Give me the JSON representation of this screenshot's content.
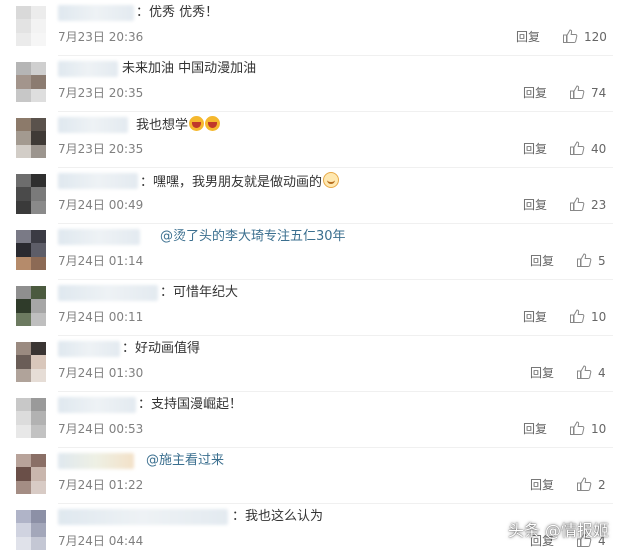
{
  "comments": [
    {
      "text_plain": "：优秀 优秀！",
      "mention": "",
      "emojis": [],
      "time": "7月23日 20:36",
      "reply": "回复",
      "likes": "120"
    },
    {
      "text_plain": "未来加油 中国动漫加油",
      "mention": "",
      "emojis": [],
      "time": "7月23日 20:35",
      "reply": "回复",
      "likes": "74"
    },
    {
      "text_plain": "我也想学",
      "mention": "",
      "emojis": [
        "laugh-emoji",
        "laugh-emoji"
      ],
      "time": "7月23日 20:35",
      "reply": "回复",
      "likes": "40"
    },
    {
      "text_plain": "：嘿嘿，我男朋友就是做动画的",
      "mention": "",
      "emojis": [
        "cat-emoji"
      ],
      "time": "7月24日 00:49",
      "reply": "回复",
      "likes": "23"
    },
    {
      "text_plain": "",
      "mention": "@烫了头的李大琦专注五仁30年",
      "emojis": [],
      "time": "7月24日 01:14",
      "reply": "回复",
      "likes": "5"
    },
    {
      "text_plain": "：可惜年纪大",
      "mention": "",
      "emojis": [],
      "time": "7月24日 00:11",
      "reply": "回复",
      "likes": "10"
    },
    {
      "text_plain": "：好动画值得",
      "mention": "",
      "emojis": [],
      "time": "7月24日 01:30",
      "reply": "回复",
      "likes": "4"
    },
    {
      "text_plain": "：支持国漫崛起！",
      "mention": "",
      "emojis": [],
      "time": "7月24日 00:53",
      "reply": "回复",
      "likes": "10"
    },
    {
      "text_plain": "",
      "mention": "@施主看过来",
      "emojis": [],
      "time": "7月24日 01:22",
      "reply": "回复",
      "likes": "2"
    },
    {
      "text_plain": "：我也这么认为",
      "mention": "",
      "emojis": [],
      "time": "7月24日 04:44",
      "reply": "回复",
      "likes": "4"
    }
  ],
  "watermark": "头条 @情报姬",
  "colors": {
    "link": "#3b6f8f",
    "meta": "#808080",
    "text": "#333333"
  }
}
